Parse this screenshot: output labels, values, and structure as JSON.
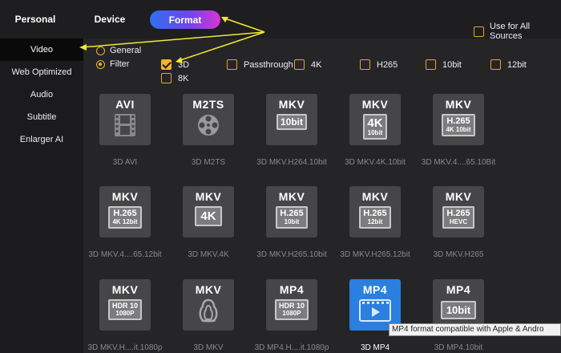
{
  "tabs": {
    "personal": "Personal",
    "device": "Device",
    "format": "Format"
  },
  "use_all_sources": {
    "label": "Use for All Sources",
    "checked": false
  },
  "sidebar": {
    "items": [
      {
        "label": "Video",
        "active": true
      },
      {
        "label": "Web Optimized",
        "active": false
      },
      {
        "label": "Audio",
        "active": false
      },
      {
        "label": "Subtitle",
        "active": false
      },
      {
        "label": "Enlarger AI",
        "active": false
      }
    ]
  },
  "mode": {
    "general": "General",
    "filter": "Filter",
    "selected": "Filter"
  },
  "filters": [
    {
      "label": "3D",
      "checked": true
    },
    {
      "label": "Passthrough",
      "checked": false
    },
    {
      "label": "4K",
      "checked": false
    },
    {
      "label": "H265",
      "checked": false
    },
    {
      "label": "10bit",
      "checked": false
    },
    {
      "label": "12bit",
      "checked": false
    },
    {
      "label": "8K",
      "checked": false
    }
  ],
  "formats": [
    {
      "title": "AVI",
      "icon": "film-strip-icon",
      "label": "3D AVI"
    },
    {
      "title": "M2TS",
      "icon": "film-reel-icon",
      "label": "3D M2TS"
    },
    {
      "title": "MKV",
      "badge": [
        "10bit"
      ],
      "label": "3D MKV.H264.10bit"
    },
    {
      "title": "MKV",
      "badge": [
        "4K",
        "10bit"
      ],
      "label": "3D MKV.4K.10bit"
    },
    {
      "title": "MKV",
      "badge": [
        "H.265",
        "4K 10bit"
      ],
      "label": "3D MKV.4....65.10Bit"
    },
    {
      "title": "MKV",
      "badge": [
        "H.265",
        "4K 12bit"
      ],
      "label": "3D MKV.4....65.12bit"
    },
    {
      "title": "MKV",
      "badge": [
        "4K"
      ],
      "label": "3D MKV.4K"
    },
    {
      "title": "MKV",
      "badge": [
        "H.265",
        "10bit"
      ],
      "label": "3D MKV.H265.10bit"
    },
    {
      "title": "MKV",
      "badge": [
        "H.265",
        "12bit"
      ],
      "label": "3D MKV.H265.12bit"
    },
    {
      "title": "MKV",
      "badge": [
        "H.265",
        "HEVC"
      ],
      "label": "3D MKV.H265"
    },
    {
      "title": "MKV",
      "badge": [
        "HDR 10",
        "1080P"
      ],
      "label": "3D MKV.H....it.1080p"
    },
    {
      "title": "MKV",
      "icon": "matryoshka-icon",
      "label": "3D MKV"
    },
    {
      "title": "MP4",
      "badge": [
        "HDR 10",
        "1080P"
      ],
      "label": "3D MP4.H....it.1080p"
    },
    {
      "title": "MP4",
      "icon": "video-play-icon",
      "label": "3D MP4",
      "selected": true
    },
    {
      "title": "MP4",
      "badge": [
        "10bit"
      ],
      "label": "3D MP4.10bit"
    }
  ],
  "tooltip": "MP4 format compatible with Apple & Andro",
  "colors": {
    "accent": "#f1b52a",
    "format_gradient": [
      "#2f6ff0",
      "#d734d6"
    ],
    "selected_tile": "#2a7fe0",
    "annotation_arrow": "#f2e830"
  }
}
